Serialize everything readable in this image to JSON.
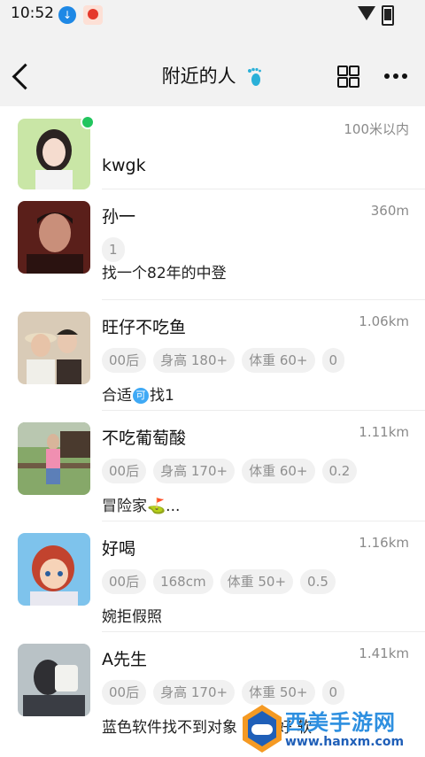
{
  "status": {
    "time": "10:52"
  },
  "header": {
    "title": "附近的人"
  },
  "people": [
    {
      "name": "kwgk",
      "distance": "100米以内",
      "tags": [],
      "bio": "",
      "online": true
    },
    {
      "name": "孙一",
      "distance": "360m",
      "tags": [
        "1"
      ],
      "bio": "找一个82年的中登"
    },
    {
      "name": "旺仔不吃鱼",
      "distance": "1.06km",
      "tags": [
        "00后",
        "身高 180+",
        "体重 60+",
        "0"
      ],
      "bio_before": "合适",
      "bio_badge": "可",
      "bio_after": "找1"
    },
    {
      "name": "不吃葡萄酸",
      "distance": "1.11km",
      "tags": [
        "00后",
        "身高 170+",
        "体重 60+",
        "0.2"
      ],
      "bio": "冒险家⛳..."
    },
    {
      "name": "好喝",
      "distance": "1.16km",
      "tags": [
        "00后",
        "168cm",
        "体重 50+",
        "0.5"
      ],
      "bio": "婉拒假照"
    },
    {
      "name": "A先生",
      "distance": "1.41km",
      "tags": [
        "00后",
        "身高 170+",
        "体重 50+",
        "0"
      ],
      "bio": "蓝色软件找不到对象 知道 好 软"
    }
  ],
  "watermark": {
    "text": "西美手游网",
    "url": "www.hanxm.com"
  }
}
